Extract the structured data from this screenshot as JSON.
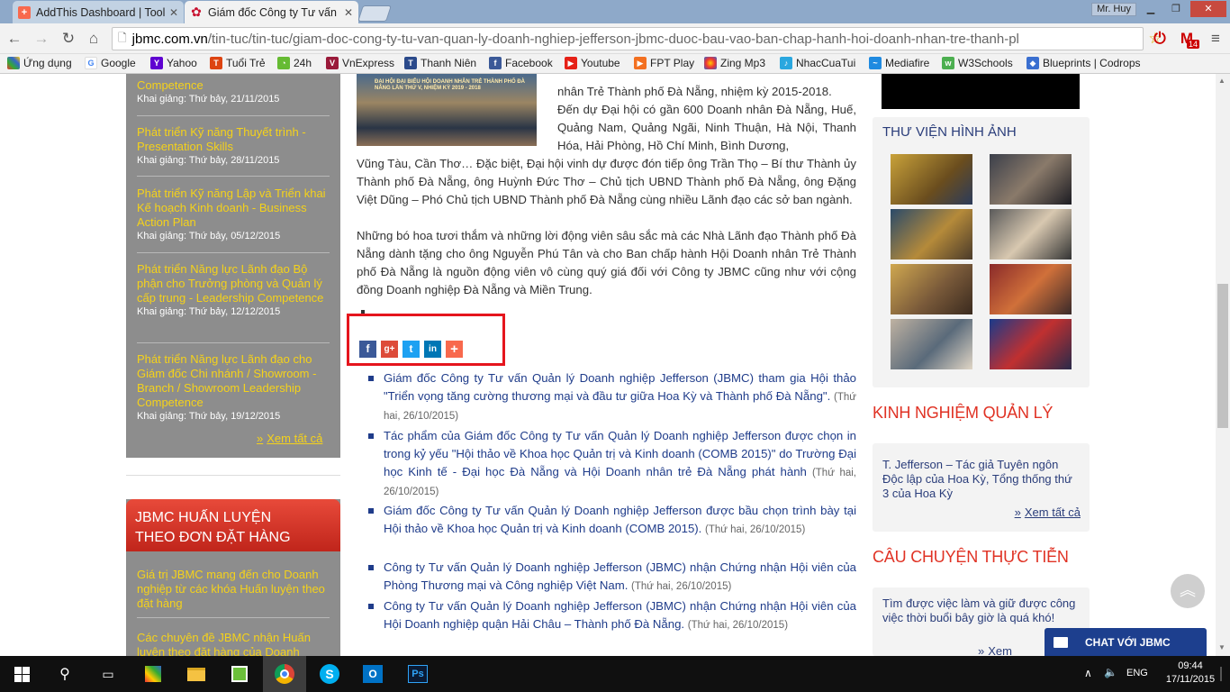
{
  "browser": {
    "tabs": [
      {
        "title": "AddThis Dashboard | Tool",
        "active": false
      },
      {
        "title": "Giám đốc Công ty Tư vấn",
        "active": true
      }
    ],
    "user": "Mr. Huy",
    "url_domain": "jbmc.com.vn",
    "url_path": "/tin-tuc/tin-tuc/giam-doc-cong-ty-tu-van-quan-ly-doanh-nghiep-jefferson-jbmc-duoc-bau-vao-ban-chap-hanh-hoi-doanh-nhan-tre-thanh-pl",
    "mail_badge": "14",
    "bookmarks": [
      "Ứng dụng",
      "Google",
      "Yahoo",
      "Tuổi Trẻ",
      "24h",
      "VnExpress",
      "Thanh Niên",
      "Facebook",
      "Youtube",
      "FPT Play",
      "Zing Mp3",
      "NhacCuaTui",
      "Mediafire",
      "W3Schools",
      "Blueprints | Codrops"
    ]
  },
  "sidebar_left": {
    "courses": [
      {
        "title": "Competence",
        "date": "Khai giảng: Thứ bảy, 21/11/2015"
      },
      {
        "title": "Phát triển Kỹ năng Thuyết trình - Presentation Skills",
        "date": "Khai giảng: Thứ bảy, 28/11/2015"
      },
      {
        "title": "Phát triển Kỹ năng Lập và Triển khai Kế hoạch Kinh doanh - Business Action Plan",
        "date": "Khai giảng: Thứ bảy, 05/12/2015"
      },
      {
        "title": "Phát triển Năng lực Lãnh đạo Bộ phận cho Trưởng phòng và Quản lý cấp trung - Leadership Competence",
        "date": "Khai giảng: Thứ bảy, 12/12/2015"
      },
      {
        "title": "Phát triển Năng lực Lãnh đạo cho Giám đốc Chi nhánh / Showroom - Branch / Showroom Leadership Competence",
        "date": "Khai giảng: Thứ bảy, 19/12/2015"
      }
    ],
    "view_all": "Xem tất cả",
    "training_title_1": "JBMC HUẤN LUYỆN",
    "training_title_2": "THEO ĐƠN ĐẶT HÀNG",
    "training_links": [
      "Giá trị JBMC mang đến cho Doanh nghiệp từ các khóa Huấn luyện theo đặt hàng",
      "Các chuyên đề JBMC nhận Huấn luyện theo đặt hàng của Doanh"
    ]
  },
  "article": {
    "photo_caption": "ĐẠI HỘI ĐẠI BIỂU HỘI DOANH NHÂN TRẺ THÀNH PHỐ ĐÀ NẴNG LẦN THỨ V, NHIỆM KỲ 2019 - 2018",
    "line1": "nhân Trẻ Thành phố Đà Nẵng, nhiệm kỳ 2015-2018.",
    "para1_a": "Đến dự Đại hội có gần 600 Doanh nhân Đà Nẵng, Huế, Quảng Nam, Quảng Ngãi, Ninh Thuận, Hà Nội, Thanh Hóa, Hải Phòng, Hồ Chí Minh, Bình Dương,",
    "para1_b": "Vũng Tàu, Cần Thơ… Đặc biệt, Đại hội vinh dự được đón tiếp ông Trần Thọ – Bí thư Thành ủy Thành phố Đà Nẵng, ông Huỳnh Đức Thơ – Chủ tịch UBND Thành phố Đà Nẵng, ông Đặng Việt Dũng – Phó Chủ tịch UBND Thành phố Đà Nẵng cùng nhiều Lãnh đạo các sở ban ngành.",
    "para2": "Những bó hoa  tươi thắm và những lời động viên sâu sắc mà các Nhà Lãnh đạo Thành phố Đà Nẵng dành tặng cho ông  Nguyễn Phú Tân và cho Ban chấp hành Hội Doanh nhân Trẻ Thành phố Đà Nẵng là nguồn động viên vô cùng quý giá đối với Công ty JBMC cũng như với cộng đồng Doanh nghiệp Đà Nẵng và Miền Trung.",
    "share_buttons": [
      {
        "name": "facebook",
        "glyph": "f",
        "color": "#3b5998"
      },
      {
        "name": "google-plus",
        "glyph": "g+",
        "color": "#dd4b39"
      },
      {
        "name": "twitter",
        "glyph": "t",
        "color": "#1da1f2"
      },
      {
        "name": "linkedin",
        "glyph": "in",
        "color": "#0077b5"
      },
      {
        "name": "more",
        "glyph": "+",
        "color": "#f8694d"
      }
    ],
    "related": [
      {
        "text": "Giám đốc Công ty Tư vấn Quản lý Doanh nghiệp Jefferson (JBMC) tham gia Hội thảo \"Triển vọng tăng cường thương mại và đầu tư giữa Hoa Kỳ và Thành phố Đà Nẵng\".",
        "date": "(Thứ hai, 26/10/2015)"
      },
      {
        "text": "Tác phẩm của Giám đốc Công ty Tư vấn Quản lý Doanh nghiệp Jefferson được chọn in trong kỷ yếu \"Hội thảo về Khoa học Quản trị và Kinh doanh (COMB 2015)\" do Trường Đại học Kinh tế - Đại học Đà Nẵng và Hội Doanh nhân trẻ Đà Nẵng phát hành",
        "date": "(Thứ hai, 26/10/2015)"
      },
      {
        "text": "Giám đốc Công ty Tư vấn Quản lý Doanh nghiệp Jefferson được bầu chọn trình bày tại Hội thảo về Khoa học Quản trị và Kinh doanh (COMB 2015).",
        "date": "(Thứ hai, 26/10/2015)"
      },
      {
        "text": "Công ty Tư vấn Quản lý Doanh nghiệp Jefferson (JBMC) nhận Chứng nhận Hội viên của Phòng Thương mại và Công nghiệp Việt Nam.",
        "date": "(Thứ hai, 26/10/2015)"
      },
      {
        "text": "Công ty Tư vấn Quản lý Doanh nghiệp Jefferson (JBMC) nhận Chứng nhận Hội viên của Hội Doanh nghiệp quận Hải Châu – Thành phố Đà Nẵng.",
        "date": "(Thứ hai, 26/10/2015)"
      }
    ]
  },
  "sidebar_right": {
    "gallery_title": "THƯ VIỆN HÌNH ẢNH",
    "experience_title": "KINH NGHIỆM QUẢN LÝ",
    "experience_text": "T. Jefferson – Tác giả Tuyên ngôn Độc lập của Hoa Kỳ, Tổng thống thứ 3 của Hoa Kỳ",
    "view_all": "Xem tất cả",
    "story_title": "CÂU CHUYỆN THỰC TIỄN",
    "story_text": "Tìm được việc làm và giữ được công việc thời buổi bây giờ là quá khó!",
    "story_more": "Xem"
  },
  "chat_label": "CHAT VỚI JBMC",
  "taskbar": {
    "lang": "ENG",
    "time": "09:44",
    "date": "17/11/2015"
  }
}
